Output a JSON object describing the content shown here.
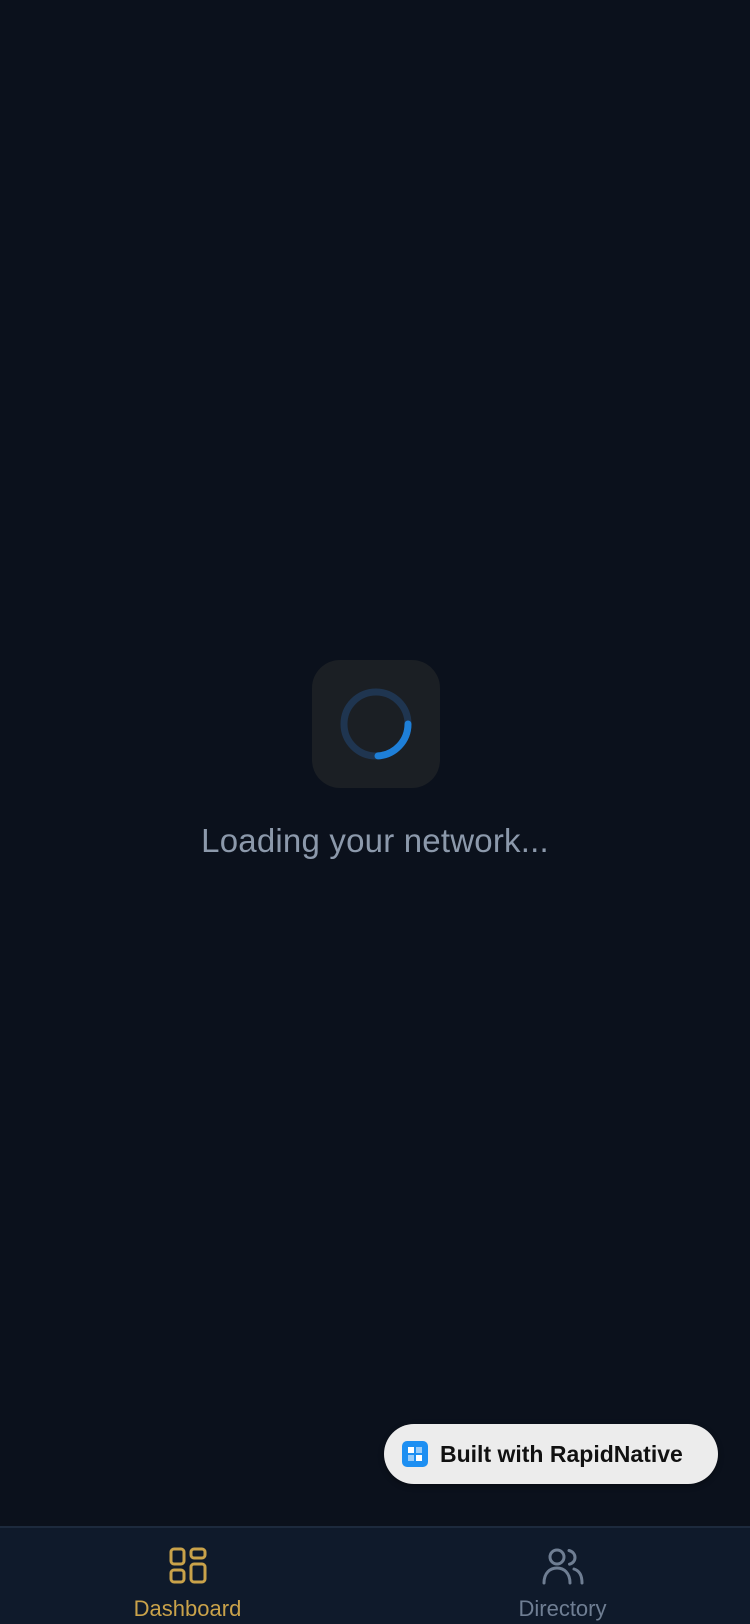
{
  "loading": {
    "text": "Loading your network..."
  },
  "badge": {
    "label": "Built with RapidNative"
  },
  "tabs": [
    {
      "label": "Dashboard",
      "icon": "grid-icon",
      "active": true
    },
    {
      "label": "Directory",
      "icon": "users-icon",
      "active": false
    }
  ],
  "colors": {
    "background": "#0b111c",
    "accent": "#c9a24a",
    "spinner": "#1e7fd8",
    "inactive": "#6f7e93"
  }
}
